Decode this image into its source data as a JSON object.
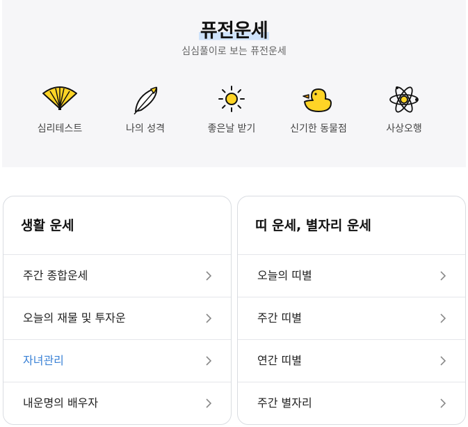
{
  "hero": {
    "title": "퓨전운세",
    "subtitle": "심심풀이로 보는 퓨전운세"
  },
  "categories": [
    {
      "label": "심리테스트",
      "icon": "fan-icon"
    },
    {
      "label": "나의 성격",
      "icon": "feather-icon"
    },
    {
      "label": "좋은날 받기",
      "icon": "sun-icon"
    },
    {
      "label": "신기한 동물점",
      "icon": "duck-icon"
    },
    {
      "label": "사상오행",
      "icon": "atom-icon"
    }
  ],
  "cards": [
    {
      "title": "생활 운세",
      "items": [
        {
          "label": "주간 종합운세"
        },
        {
          "label": "오늘의 재물 및 투자운"
        },
        {
          "label": "자녀관리",
          "active": true
        },
        {
          "label": "내운명의 배우자"
        }
      ]
    },
    {
      "title": "띠 운세, 별자리 운세",
      "items": [
        {
          "label": "오늘의 띠별"
        },
        {
          "label": "주간 띠별"
        },
        {
          "label": "연간 띠별"
        },
        {
          "label": "주간 별자리"
        }
      ]
    }
  ],
  "colors": {
    "accent": "#3b82d6",
    "icon_yellow": "#ffd426",
    "hero_bg": "#f6f6f8"
  }
}
